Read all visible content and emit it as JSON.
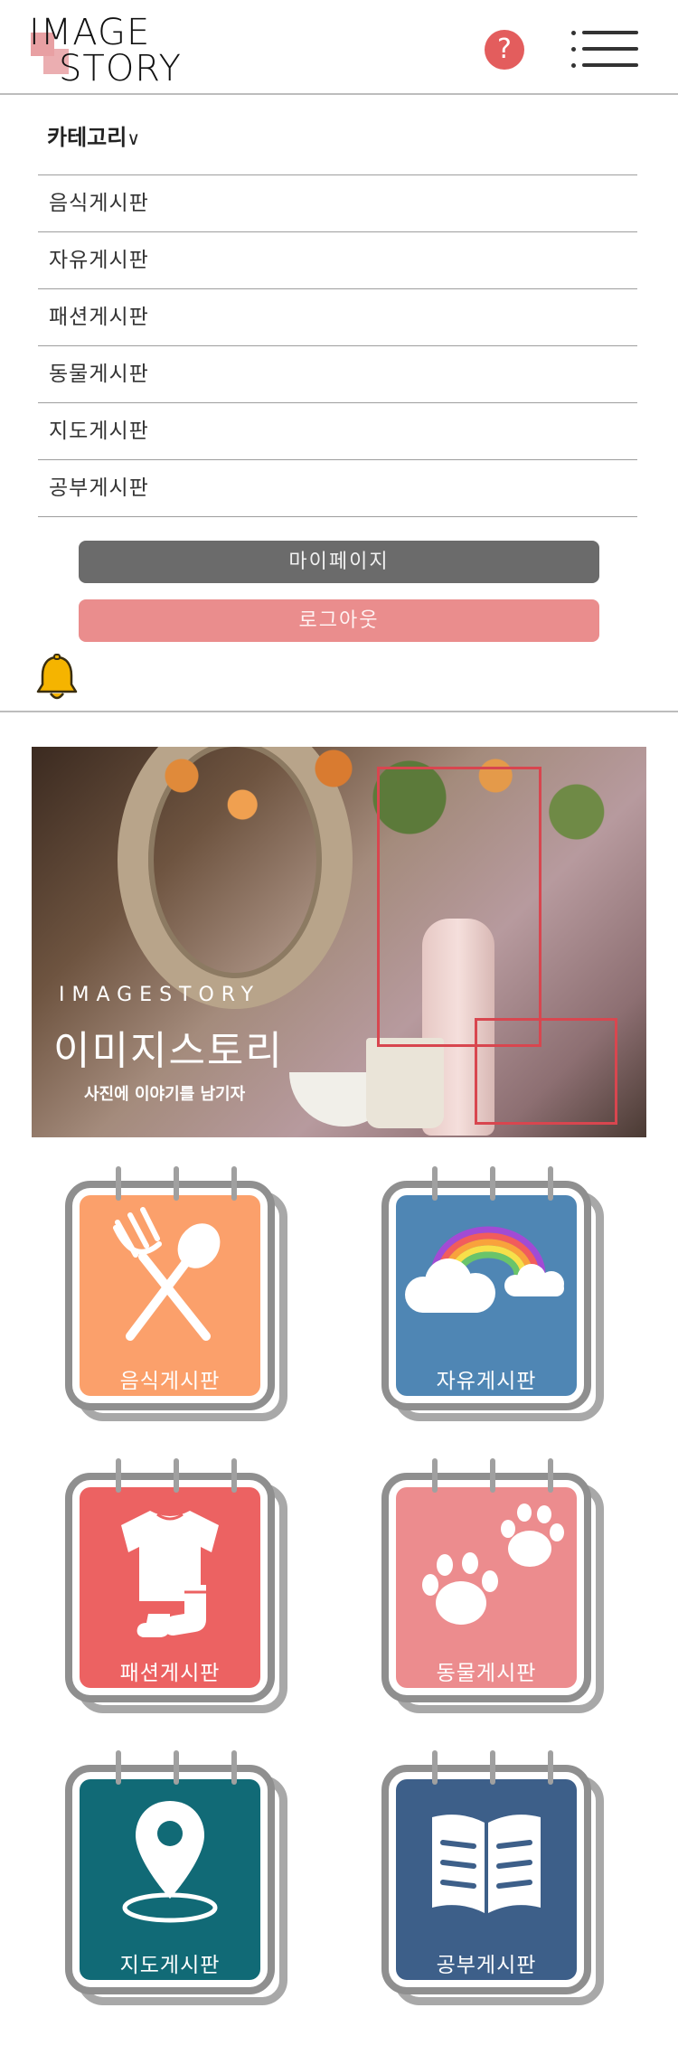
{
  "header": {
    "logo_line1": "IMAGE",
    "logo_line2": "STORY",
    "help_icon": "?"
  },
  "category": {
    "heading": "카테고리",
    "items": [
      {
        "label": "음식게시판"
      },
      {
        "label": "자유게시판"
      },
      {
        "label": "패션게시판"
      },
      {
        "label": "동물게시판"
      },
      {
        "label": "지도게시판"
      },
      {
        "label": "공부게시판"
      }
    ]
  },
  "buttons": {
    "mypage": "마이페이지",
    "logout": "로그아웃"
  },
  "banner": {
    "en_title": "IMAGESTORY",
    "ko_title": "이미지스토리",
    "subtitle": "사진에 이야기를 남기자"
  },
  "boards": [
    {
      "label": "음식게시판",
      "color": "#fba06b",
      "icon": "fork-spoon-icon"
    },
    {
      "label": "자유게시판",
      "color": "#4f86b4",
      "icon": "rainbow-cloud-icon"
    },
    {
      "label": "패션게시판",
      "color": "#ec6262",
      "icon": "clothes-icon"
    },
    {
      "label": "동물게시판",
      "color": "#ec8c8e",
      "icon": "paw-icon"
    },
    {
      "label": "지도게시판",
      "color": "#116a76",
      "icon": "map-pin-icon"
    },
    {
      "label": "공부게시판",
      "color": "#3d5f89",
      "icon": "book-icon"
    }
  ],
  "colors": {
    "accent_red": "#e35d5d",
    "mypage_button": "#6b6b6b",
    "logout_button": "#ea8d8d",
    "bell": "#f5b400"
  }
}
